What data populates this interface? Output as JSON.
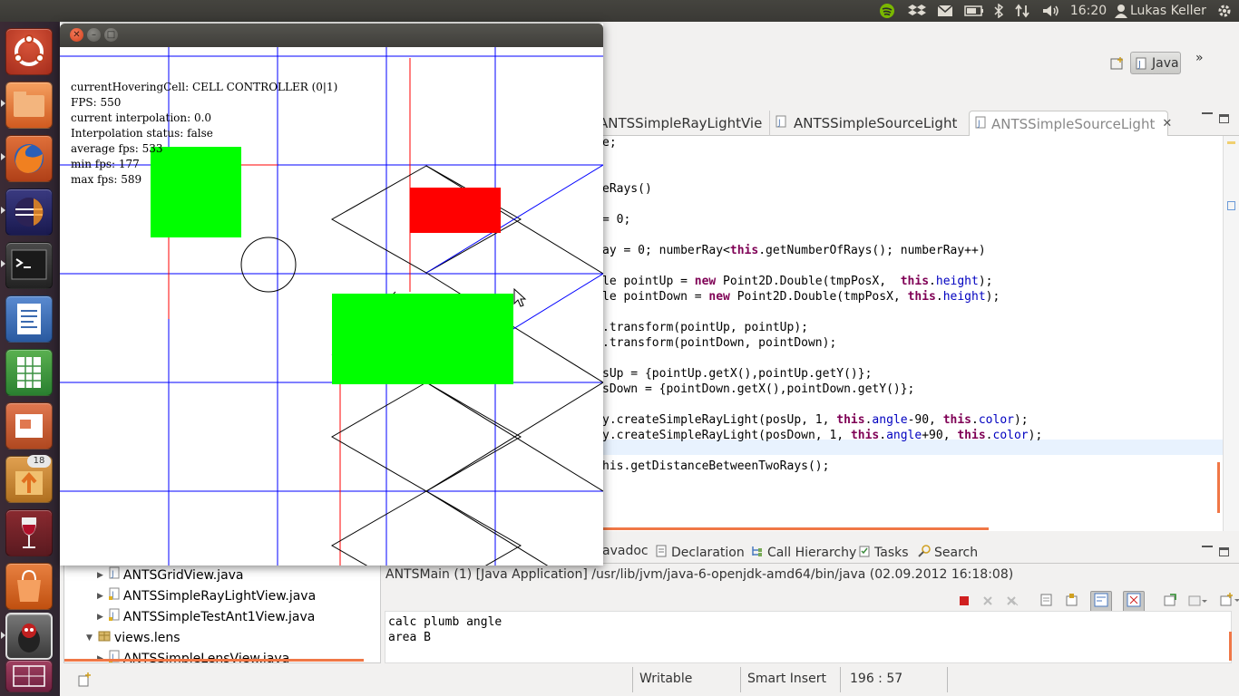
{
  "top_panel": {
    "clock": "16:20",
    "user": "Lukas Keller",
    "icons": [
      "spotify-icon",
      "dropbox-icon",
      "mail-icon",
      "battery-icon",
      "bluetooth-icon",
      "network-icon",
      "volume-icon",
      "user-icon",
      "gear-icon"
    ]
  },
  "launcher": {
    "items": [
      "ubuntu-dash",
      "files",
      "firefox",
      "eclipse",
      "terminal",
      "libreoffice-writer",
      "libreoffice-calc",
      "libreoffice-impress",
      "update-manager",
      "wine",
      "software-center",
      "java-app",
      "workspace-switcher"
    ],
    "update_badge": "18"
  },
  "eclipse": {
    "perspective_label": "Java",
    "editor_tabs": [
      {
        "label": "ANTSSimpleRayLightVie"
      },
      {
        "label": "ANTSSimpleSourceLight"
      },
      {
        "label": "ANTSSimpleSourceLight"
      }
    ],
    "code_lines": [
      {
        "t": "e;"
      },
      {
        "t": ""
      },
      {
        "t": ""
      },
      {
        "t": "eRays()"
      },
      {
        "t": ""
      },
      {
        "t": "= 0;"
      },
      {
        "t": ""
      },
      {
        "t": "ay = 0; numberRay<this.getNumberOfRays(); numberRay++)"
      },
      {
        "t": ""
      },
      {
        "t": "le pointUp = new Point2D.Double(tmpPosX,  this.height);"
      },
      {
        "t": "le pointDown = new Point2D.Double(tmpPosX, this.height);"
      },
      {
        "t": ""
      },
      {
        "t": ".transform(pointUp, pointUp);"
      },
      {
        "t": ".transform(pointDown, pointDown);"
      },
      {
        "t": ""
      },
      {
        "t": "sUp = {pointUp.getX(),pointUp.getY()};"
      },
      {
        "t": "sDown = {pointDown.getX(),pointDown.getY()};"
      },
      {
        "t": ""
      },
      {
        "t": "y.createSimpleRayLight(posUp, 1, this.angle-90, this.color);"
      },
      {
        "t": "y.createSimpleRayLight(posDown, 1, this.angle+90, this.color);"
      },
      {
        "t": ""
      },
      {
        "t": "his.getDistanceBetweenTwoRays();"
      }
    ],
    "bottom_tabs": [
      {
        "label": "avadoc",
        "icon": "javadoc-icon"
      },
      {
        "label": "Declaration",
        "icon": "declaration-icon"
      },
      {
        "label": "Call Hierarchy",
        "icon": "call-hierarchy-icon"
      },
      {
        "label": "Tasks",
        "icon": "tasks-icon"
      },
      {
        "label": "Search",
        "icon": "search-icon"
      }
    ],
    "console": {
      "header": "ANTSMain (1) [Java Application] /usr/lib/jvm/java-6-openjdk-amd64/bin/java (02.09.2012 16:18:08)",
      "lines": [
        "calc plumb angle",
        "area B"
      ]
    },
    "package_explorer": {
      "items": [
        {
          "label": "ANTSGridView.java",
          "level": 2
        },
        {
          "label": "ANTSSimpleRayLightView.java",
          "level": 2
        },
        {
          "label": "ANTSSimpleTestAnt1View.java",
          "level": 2
        },
        {
          "label": "views.lens",
          "level": 1
        },
        {
          "label": "ANTSSimpleLensView.java",
          "level": 2
        }
      ]
    },
    "status_bar": {
      "writable": "Writable",
      "insert_mode": "Smart Insert",
      "position": "196 : 57"
    }
  },
  "java_app": {
    "overlay": [
      "currentHoveringCell: CELL CONTROLLER (0|1)",
      "FPS: 550",
      "current interpolation: 0.0",
      "Interpolation status: false",
      "average fps: 533",
      "min fps: 177",
      "max fps: 589"
    ]
  },
  "colors": {
    "grid_line": "#0000ff",
    "ray_line": "#ff0000",
    "source_block": "#00ff00",
    "target_block": "#ff0000",
    "accent": "#f07746"
  }
}
